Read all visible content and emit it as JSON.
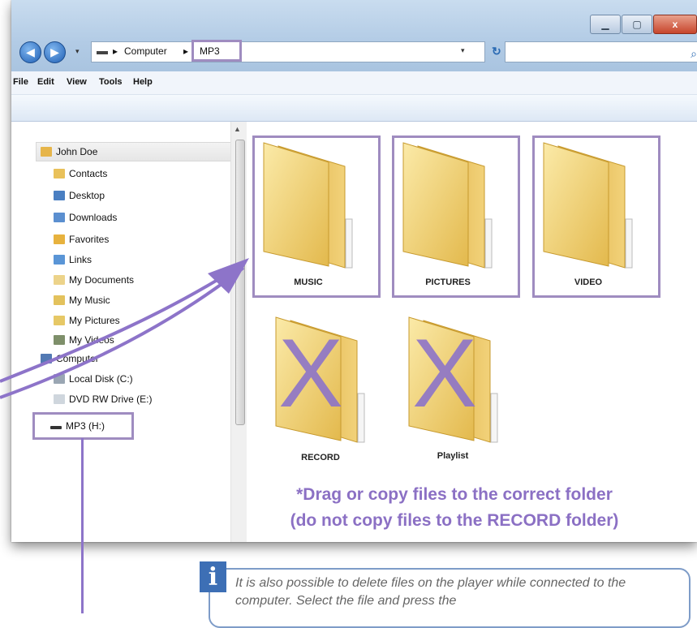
{
  "window": {
    "controls": {
      "minimize": "▁",
      "maximize": "▢",
      "close": "x"
    }
  },
  "address": {
    "breadcrumbs": [
      "Computer",
      "MP3"
    ],
    "separator": "▸",
    "dropdown_arrow": "▾",
    "refresh_icon": "↻",
    "search_icon": "⌕"
  },
  "menu": [
    "File",
    "Edit",
    "View",
    "Tools",
    "Help"
  ],
  "nav": {
    "root": "John Doe",
    "items": [
      "Contacts",
      "Desktop",
      "Downloads",
      "Favorites",
      "Links",
      "My Documents",
      "My Music",
      "My Pictures",
      "My Videos"
    ],
    "computer": "Computer",
    "drives": [
      "Local Disk (C:)",
      "DVD RW Drive (E:)",
      "MP3 (H:)"
    ]
  },
  "folders": [
    {
      "name": "MUSIC",
      "highlighted": true,
      "crossed": false
    },
    {
      "name": "PICTURES",
      "highlighted": true,
      "crossed": false
    },
    {
      "name": "VIDEO",
      "highlighted": true,
      "crossed": false
    },
    {
      "name": "RECORD",
      "highlighted": false,
      "crossed": true
    },
    {
      "name": "Playlist",
      "highlighted": false,
      "crossed": true
    }
  ],
  "cross_mark": "X",
  "instructions": {
    "line1": "*Drag or copy files to the correct folder",
    "line2": "(do not copy files to the RECORD folder)"
  },
  "info": {
    "icon_letter": "i",
    "text": "It is also possible to delete files on the player while connected to the computer.  Select the file and press the"
  },
  "colors": {
    "accent_purple": "#8d74c9",
    "highlight_border": "#9f8cc0",
    "folder_yellow": "#f3d67a",
    "info_blue": "#3d6fb5"
  }
}
